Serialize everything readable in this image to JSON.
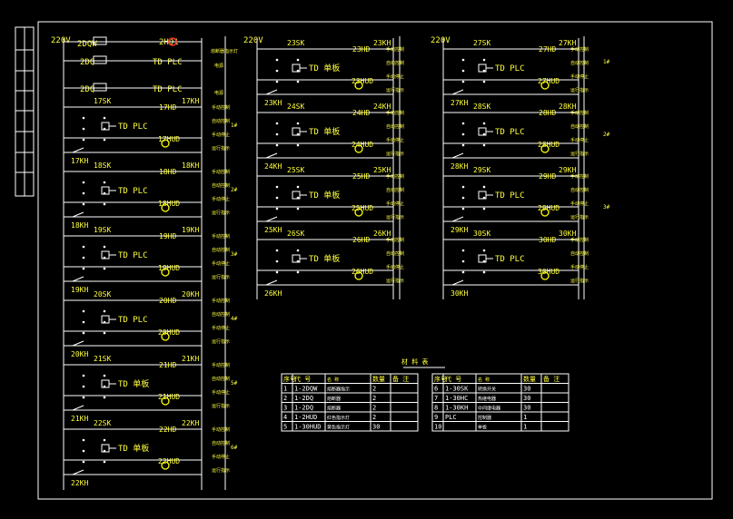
{
  "colors": {
    "background": "#000000",
    "line": "#ffffff",
    "label": "#ffff3c",
    "lamp": "#ffff00",
    "highlight": "#ff3030"
  },
  "supply": "220V",
  "device_label": "TD",
  "plc_label": "PLC",
  "top_rows": [
    {
      "left": "2DQW",
      "right": "2HD1",
      "mid": "",
      "note": "熔断器指示灯"
    },
    {
      "left": "2DQ",
      "right": "",
      "mid": "TD PLC",
      "note": "电源"
    },
    {
      "left": "2DQ",
      "right": "",
      "mid": "TD PLC",
      "note": "电源"
    }
  ],
  "circuits": [
    {
      "col": 0,
      "sk": "17SK",
      "hd": "17HD",
      "kh": "17KH",
      "hud": "17HUD",
      "dev": "TD PLC"
    },
    {
      "col": 0,
      "sk": "18SK",
      "hd": "18HD",
      "kh": "18KH",
      "hud": "18HUD",
      "dev": "TD PLC"
    },
    {
      "col": 0,
      "sk": "19SK",
      "hd": "19HD",
      "kh": "19KH",
      "hud": "19HUD",
      "dev": "TD PLC"
    },
    {
      "col": 0,
      "sk": "20SK",
      "hd": "20HD",
      "kh": "20KH",
      "hud": "20HUD",
      "dev": "TD PLC"
    },
    {
      "col": 0,
      "sk": "21SK",
      "hd": "21HD",
      "kh": "21KH",
      "hud": "21HUD",
      "dev": "TD 单板"
    },
    {
      "col": 0,
      "sk": "22SK",
      "hd": "22HD",
      "kh": "22KH",
      "hud": "22HUD",
      "dev": "TD 单板"
    },
    {
      "col": 1,
      "sk": "23SK",
      "hd": "23HD",
      "kh": "23KH",
      "hud": "23HUD",
      "dev": "TD 单板"
    },
    {
      "col": 1,
      "sk": "24SK",
      "hd": "24HD",
      "kh": "24KH",
      "hud": "24HUD",
      "dev": "TD 单板"
    },
    {
      "col": 1,
      "sk": "25SK",
      "hd": "25HD",
      "kh": "25KH",
      "hud": "25HUD",
      "dev": "TD 单板"
    },
    {
      "col": 1,
      "sk": "26SK",
      "hd": "26HD",
      "kh": "26KH",
      "hud": "26HUD",
      "dev": "TD 单板"
    },
    {
      "col": 2,
      "sk": "27SK",
      "hd": "27HD",
      "kh": "27KH",
      "hud": "27HUD",
      "dev": "TD PLC"
    },
    {
      "col": 2,
      "sk": "28SK",
      "hd": "28HD",
      "kh": "28KH",
      "hud": "28HUD",
      "dev": "TD PLC"
    },
    {
      "col": 2,
      "sk": "29SK",
      "hd": "29HD",
      "kh": "29KH",
      "hud": "29HUD",
      "dev": "TD PLC"
    },
    {
      "col": 2,
      "sk": "30SK",
      "hd": "30HD",
      "kh": "30KH",
      "hud": "30HUD",
      "dev": "TD PLC"
    }
  ],
  "notes": [
    "手动控制",
    "自动控制",
    "手动停止",
    "运行指示",
    "故障指示"
  ],
  "group_labels": [
    "1#",
    "2#",
    "3#",
    "4#",
    "5#",
    "6#",
    "1#",
    "2#",
    "3#"
  ],
  "materials_title": "材 料 表",
  "materials_header": [
    "序号",
    "代 号",
    "名  称",
    "数量",
    "备 注"
  ],
  "materials_left": [
    [
      "1",
      "1-2DQW",
      "熔断器指示",
      "2",
      ""
    ],
    [
      "2",
      "1-2DQ",
      "熔断器",
      "2",
      ""
    ],
    [
      "3",
      "1-2DQ",
      "熔断器",
      "2",
      ""
    ],
    [
      "4",
      "1-2HUD",
      "红色指示灯",
      "2",
      ""
    ],
    [
      "5",
      "1-30HUD",
      "黄色指示灯",
      "30",
      ""
    ]
  ],
  "materials_right": [
    [
      "6",
      "1-30SK",
      "转换开关",
      "30",
      ""
    ],
    [
      "7",
      "1-30HC",
      "热继电器",
      "30",
      ""
    ],
    [
      "8",
      "1-30KH",
      "中间继电器",
      "30",
      ""
    ],
    [
      "9",
      "PLC",
      "控制器",
      "1",
      ""
    ],
    [
      "10",
      "",
      "单板",
      "1",
      ""
    ]
  ]
}
